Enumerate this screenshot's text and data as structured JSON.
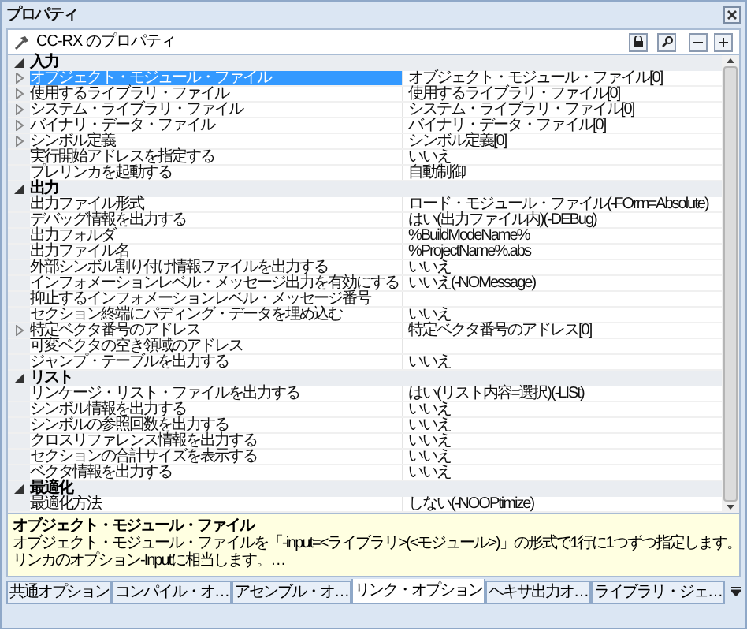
{
  "window": {
    "title": "プロパティ"
  },
  "toolbar": {
    "title": "CC-RX のプロパティ"
  },
  "groups": [
    {
      "name": "入力",
      "expanded": true,
      "rows": [
        {
          "name": "オブジェクト・モジュール・ファイル",
          "value": "オブジェクト・モジュール・ファイル[0]",
          "expandable": true,
          "selected": true
        },
        {
          "name": "使用するライブラリ・ファイル",
          "value": "使用するライブラリ・ファイル[0]",
          "expandable": true,
          "selected": false
        },
        {
          "name": "システム・ライブラリ・ファイル",
          "value": "システム・ライブラリ・ファイル[0]",
          "expandable": true,
          "selected": false
        },
        {
          "name": "バイナリ・データ・ファイル",
          "value": "バイナリ・データ・ファイル[0]",
          "expandable": true,
          "selected": false
        },
        {
          "name": "シンボル定義",
          "value": "シンボル定義[0]",
          "expandable": true,
          "selected": false
        },
        {
          "name": "実行開始アドレスを指定する",
          "value": "いいえ",
          "expandable": false,
          "selected": false
        },
        {
          "name": "プレリンカを起動する",
          "value": "自動制御",
          "expandable": false,
          "selected": false
        }
      ]
    },
    {
      "name": "出力",
      "expanded": true,
      "rows": [
        {
          "name": "出力ファイル形式",
          "value": "ロード・モジュール・ファイル(-FOrm=Absolute)",
          "expandable": false,
          "selected": false
        },
        {
          "name": "デバッグ情報を出力する",
          "value": "はい(出力ファイル内)(-DEBug)",
          "expandable": false,
          "selected": false
        },
        {
          "name": "出力フォルダ",
          "value": "%BuildModeName%",
          "expandable": false,
          "selected": false
        },
        {
          "name": "出力ファイル名",
          "value": "%ProjectName%.abs",
          "expandable": false,
          "selected": false
        },
        {
          "name": "外部シンボル割り付け情報ファイルを出力する",
          "value": "いいえ",
          "expandable": false,
          "selected": false
        },
        {
          "name": "インフォメーションレベル・メッセージ出力を有効にする",
          "value": "いいえ(-NOMessage)",
          "expandable": false,
          "selected": false
        },
        {
          "name": "抑止するインフォメーションレベル・メッセージ番号",
          "expandable": false,
          "selected": false
        },
        {
          "name": "セクション終端にパディング・データを埋め込む",
          "value": "いいえ",
          "expandable": false,
          "selected": false
        },
        {
          "name": "特定ベクタ番号のアドレス",
          "value": "特定ベクタ番号のアドレス[0]",
          "expandable": true,
          "selected": false
        },
        {
          "name": "可変ベクタの空き領域のアドレス",
          "expandable": false,
          "selected": false
        },
        {
          "name": "ジャンプ・テーブルを出力する",
          "value": "いいえ",
          "expandable": false,
          "selected": false
        }
      ]
    },
    {
      "name": "リスト",
      "expanded": true,
      "rows": [
        {
          "name": "リンケージ・リスト・ファイルを出力する",
          "value": "はい(リスト内容=選択)(-LISt)",
          "expandable": false,
          "selected": false
        },
        {
          "name": "シンボル情報を出力する",
          "value": "いいえ",
          "expandable": false,
          "selected": false
        },
        {
          "name": "シンボルの参照回数を出力する",
          "value": "いいえ",
          "expandable": false,
          "selected": false
        },
        {
          "name": "クロスリファレンス情報を出力する",
          "value": "いいえ",
          "expandable": false,
          "selected": false
        },
        {
          "name": "セクションの合計サイズを表示する",
          "value": "いいえ",
          "expandable": false,
          "selected": false
        },
        {
          "name": "ベクタ情報を出力する",
          "value": "いいえ",
          "expandable": false,
          "selected": false
        }
      ]
    },
    {
      "name": "最適化",
      "expanded": true,
      "rows": [
        {
          "name": "最適化方法",
          "value": "しない(-NOOPtimize)",
          "expandable": false,
          "selected": false
        }
      ]
    }
  ],
  "description": {
    "title": "オブジェクト・モジュール・ファイル",
    "text": "オブジェクト・モジュール・ファイルを「-input=<ライブラリ>(<モジュール>)」の形式で1行に1つずつ指定します。",
    "text_2": "リンカのオプション-Inputに相当します。…"
  },
  "tabs": [
    {
      "label": "共通オプション",
      "selected": false
    },
    {
      "label": "コンパイル・オ…",
      "selected": false
    },
    {
      "label": "アセンブル・オ…",
      "selected": false
    },
    {
      "label": "リンク・オプション",
      "selected": true
    },
    {
      "label": "ヘキサ出力オ…",
      "selected": false
    },
    {
      "label": "ライブラリ・ジェ…",
      "selected": false
    }
  ]
}
